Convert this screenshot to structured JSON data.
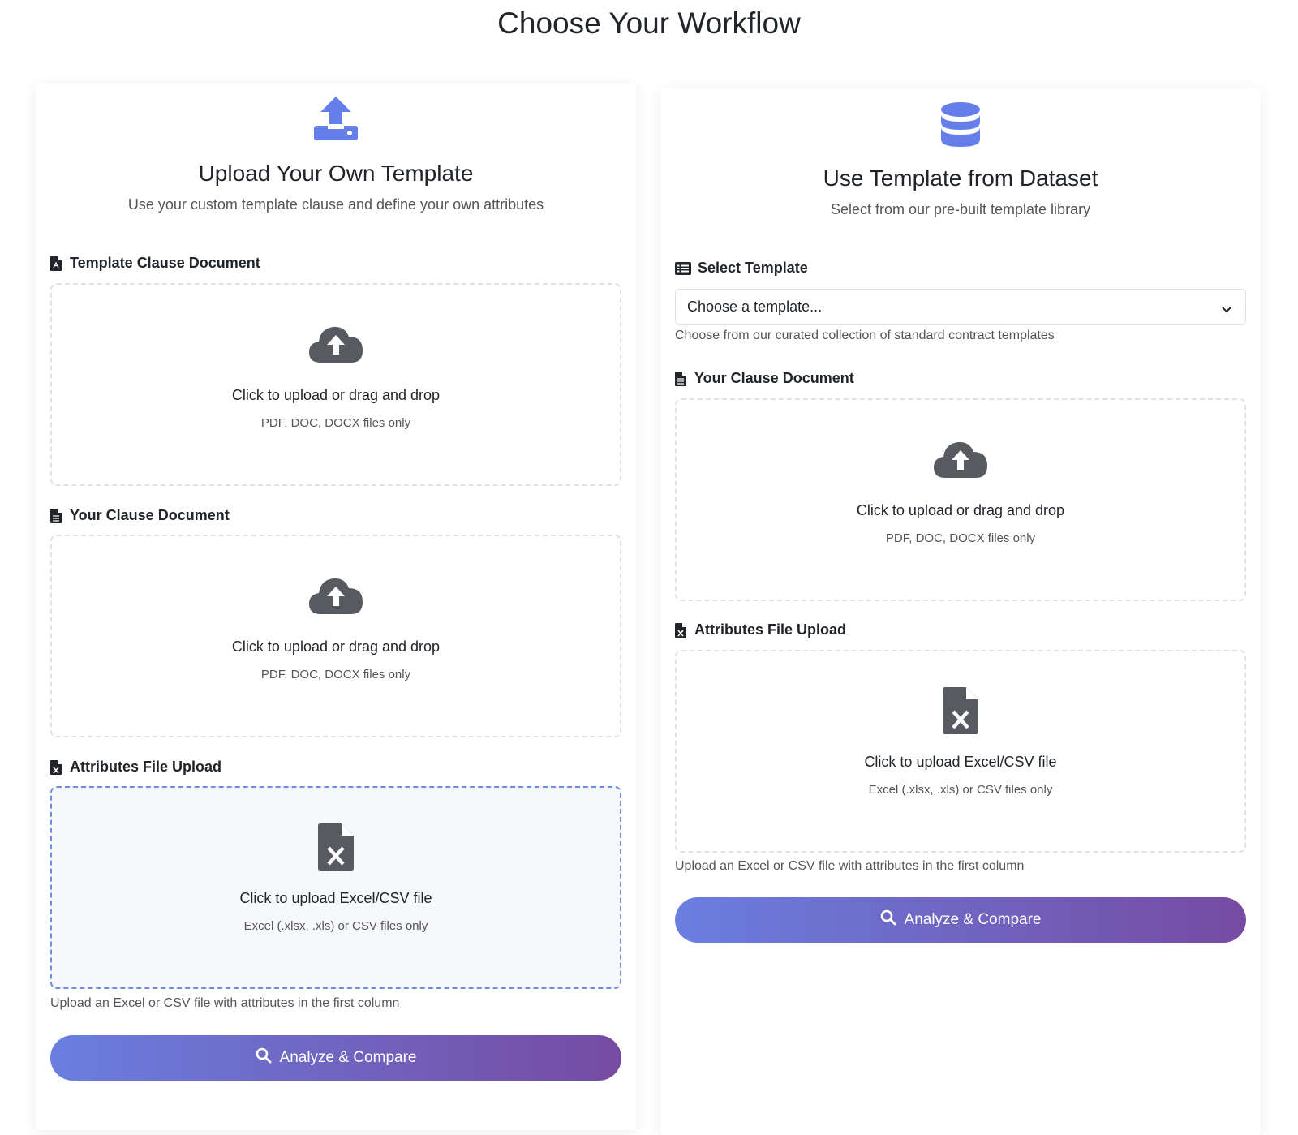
{
  "page": {
    "title": "Choose Your Workflow"
  },
  "left": {
    "icon": "upload-tray-icon",
    "title": "Upload Your Own Template",
    "subtitle": "Use your custom template clause and define your own attributes",
    "template_section": {
      "label": "Template Clause Document",
      "icon": "file-pdf-icon",
      "upload_text": "Click to upload or drag and drop",
      "upload_hint": "PDF, DOC, DOCX files only"
    },
    "clause_section": {
      "label": "Your Clause Document",
      "icon": "file-text-icon",
      "upload_text": "Click to upload or drag and drop",
      "upload_hint": "PDF, DOC, DOCX files only"
    },
    "attributes_section": {
      "label": "Attributes File Upload",
      "icon": "file-excel-icon",
      "upload_text": "Click to upload Excel/CSV file",
      "upload_hint": "Excel (.xlsx, .xls) or CSV files only",
      "help": "Upload an Excel or CSV file with attributes in the first column"
    },
    "button": "Analyze & Compare"
  },
  "right": {
    "icon": "database-icon",
    "title": "Use Template from Dataset",
    "subtitle": "Select from our pre-built template library",
    "select_section": {
      "label": "Select Template",
      "icon": "list-icon",
      "value": "Choose a template...",
      "help": "Choose from our curated collection of standard contract templates"
    },
    "clause_section": {
      "label": "Your Clause Document",
      "icon": "file-text-icon",
      "upload_text": "Click to upload or drag and drop",
      "upload_hint": "PDF, DOC, DOCX files only"
    },
    "attributes_section": {
      "label": "Attributes File Upload",
      "icon": "file-excel-icon",
      "upload_text": "Click to upload Excel/CSV file",
      "upload_hint": "Excel (.xlsx, .xls) or CSV files only",
      "help": "Upload an Excel or CSV file with attributes in the first column"
    },
    "button": "Analyze & Compare"
  },
  "colors": {
    "accent": "#667eea",
    "accent_end": "#764ba2",
    "icon_gray": "#575b60",
    "active_border": "#6c8fd8"
  }
}
